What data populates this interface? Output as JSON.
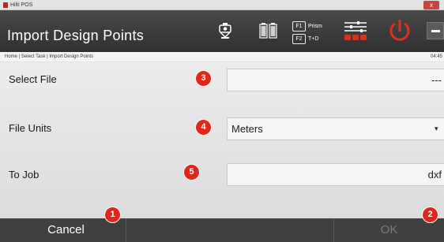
{
  "window": {
    "app_name": "Hilti POS",
    "close_label": "x"
  },
  "header": {
    "title": "Import Design Points",
    "fkeys": [
      {
        "key": "F1",
        "label": "Prism"
      },
      {
        "key": "F2",
        "label": "T+D"
      }
    ]
  },
  "breadcrumb": {
    "path": "Home | Select Task | Import Design Points",
    "time": "04:45"
  },
  "form": {
    "select_file": {
      "label": "Select File",
      "value": "---",
      "badge": "3"
    },
    "file_units": {
      "label": "File Units",
      "value": "Meters",
      "caret": "▾",
      "badge": "4"
    },
    "to_job": {
      "label": "To Job",
      "value": "dxf",
      "badge": "5"
    }
  },
  "footer": {
    "cancel_label": "Cancel",
    "cancel_badge": "1",
    "ok_label": "OK",
    "ok_badge": "2"
  },
  "colors": {
    "badge": "#e32419",
    "power_icon": "#e0301e",
    "settings_bar": "#d6321f"
  }
}
